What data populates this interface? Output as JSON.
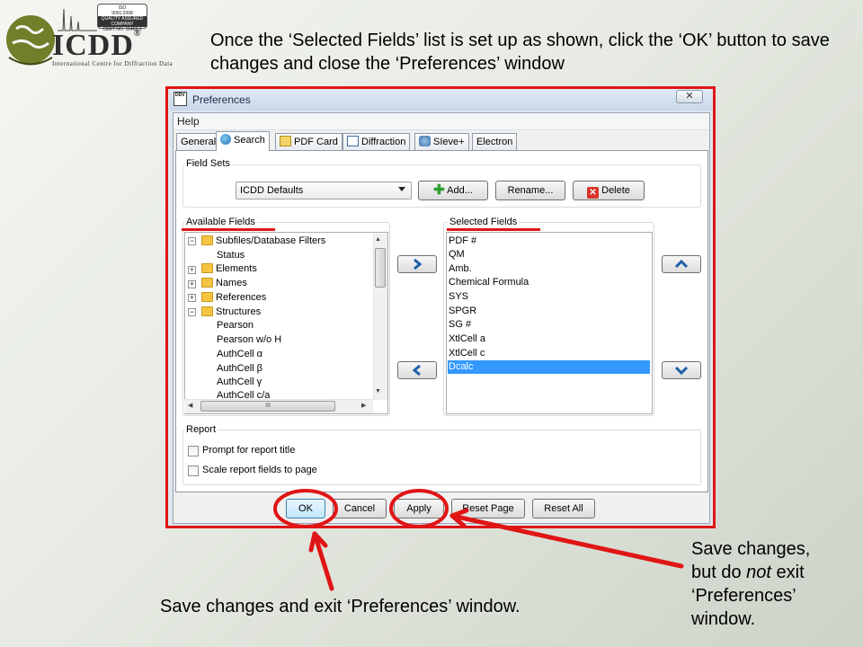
{
  "logo": {
    "name": "ICDD",
    "reg": "®",
    "subtitle": "International Centre for Diffraction Data",
    "seal": [
      "ISO",
      "9001:2008",
      "QUALITY ASSURED COMPANY",
      "CERT NO.",
      "11468-1"
    ]
  },
  "instruction": "Once the ‘Selected Fields’ list is set up as shown, click the ‘OK’ button to save changes and close the ‘Preferences’ window",
  "window": {
    "title": "Preferences",
    "icon_text": "DDV",
    "close": "✕"
  },
  "menu": {
    "help": "Help"
  },
  "tabs": [
    {
      "label": "General",
      "active": false
    },
    {
      "label": "Search",
      "active": true
    },
    {
      "label": "PDF Card",
      "active": false
    },
    {
      "label": "Diffraction",
      "active": false
    },
    {
      "label": "SIeve+",
      "active": false
    },
    {
      "label": "Electron",
      "active": false
    }
  ],
  "field_sets": {
    "label": "Field Sets",
    "selected": "ICDD Defaults",
    "add": "Add...",
    "rename": "Rename...",
    "delete": "Delete"
  },
  "available": {
    "label": "Available Fields",
    "items": [
      "Subfiles/Database Filters",
      "Status",
      "Elements",
      "Names",
      "References",
      "Structures",
      "Pearson",
      "Pearson w/o H",
      "AuthCell α",
      "AuthCell β",
      "AuthCell γ",
      "AuthCell c/a"
    ],
    "scroll_grip": "III"
  },
  "selected": {
    "label": "Selected Fields",
    "items": [
      "PDF #",
      "QM",
      "Amb.",
      "Chemical Formula",
      "SYS",
      "SPGR",
      "SG #",
      "XtlCell a",
      "XtlCell c",
      "Dcalc"
    ],
    "highlighted": "Dcalc"
  },
  "report": {
    "label": "Report",
    "prompt": "Prompt for report title",
    "scale": "Scale report fields to page"
  },
  "buttons": {
    "ok": "OK",
    "cancel": "Cancel",
    "apply": "Apply",
    "reset_page": "Reset Page",
    "reset_all": "Reset All"
  },
  "annotations": {
    "ok_note": "Save changes and exit ‘Preferences’ window.",
    "apply_line1": "Save changes,",
    "apply_line2_pre": "but do ",
    "apply_line2_em": "not",
    "apply_line2_post": " exit",
    "apply_line3": "‘Preferences’",
    "apply_line4": "window."
  },
  "colors": {
    "highlight_red": "#e01515",
    "selection_blue": "#3399ff"
  }
}
